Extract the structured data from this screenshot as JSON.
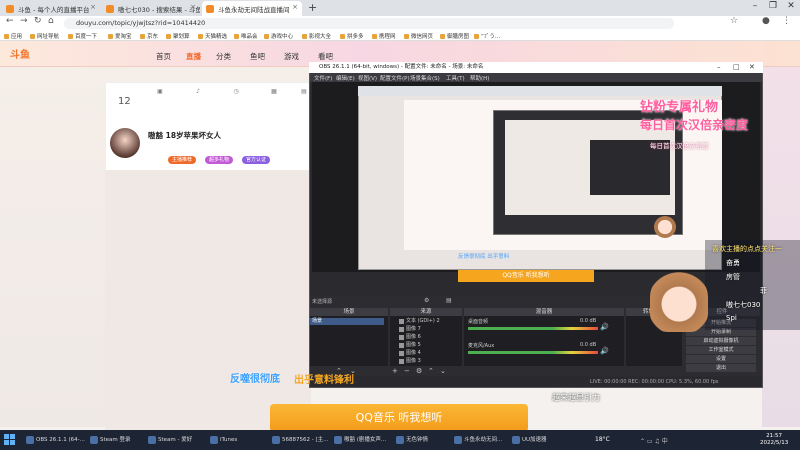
{
  "browser": {
    "tabs": [
      {
        "label": "斗鱼 - 每个人的直播平台"
      },
      {
        "label": "嗷七七030 - 搜索结果 - 斗鱼直播"
      },
      {
        "label": "斗鱼永劫无间陆战直播间"
      }
    ],
    "url": "douyu.com/topic/yjwjtsz?rid=10414420",
    "bookmarks": [
      "应用",
      "网址导航",
      "百度一下",
      "爱淘宝",
      "京东",
      "聚划算",
      "天猫精选",
      "唯品会",
      "游戏中心",
      "影视大全",
      "拼多多",
      "携程网",
      "微信网页",
      "御膳房图",
      "“ﾌﾞう..."
    ]
  },
  "site": {
    "logo": "斗鱼",
    "nav": [
      "首页",
      "直播",
      "分类",
      "鱼吧",
      "游戏",
      "看吧"
    ],
    "room": {
      "count": "12",
      "streamer_name": "嗷豁 18岁苹果坏女人",
      "chips": [
        "主播推荐",
        "超多礼物",
        "官方认证"
      ]
    }
  },
  "promo": {
    "line1": "钻粉专属礼物",
    "line2": "每日首次汉倍亲密度",
    "line3": "每日首次汉倍亲密度"
  },
  "obs": {
    "title": "OBS 26.1.1 (64-bit, windows) - 配置文件: 未命名 - 场景: 未命名",
    "menu": [
      "文件(F)",
      "编辑(E)",
      "视图(V)",
      "配置文件(P)",
      "场景集合(S)",
      "工具(T)",
      "帮助(H)"
    ],
    "inner_banner": "反馈很彻底 出乎意料",
    "inner_yellow": "QQ音乐 听我想听",
    "no_source": "未选择源",
    "dock_titles": [
      "场景",
      "来源",
      "混音器",
      "转场特效",
      "控件"
    ],
    "scene_item": "场景",
    "sources": [
      "文本 (GDI+) 2",
      "图像 7",
      "图像 6",
      "图像 5",
      "图像 4",
      "图像 3"
    ],
    "mixer": [
      {
        "name": "桌面音频",
        "level": "0.0 dB"
      },
      {
        "name": "麦克风/Aux",
        "level": "0.0 dB"
      }
    ],
    "controls": [
      "开始推流",
      "开始录制",
      "启动虚拟摄像机",
      "工作室模式",
      "设置",
      "退出"
    ],
    "status": "LIVE: 00:00:00   REC: 00:00:00   CPU: 5.3%, 60.00 fps"
  },
  "overlay": {
    "banner_blue": "反噬很彻底",
    "banner_orange": "出乎意料锋利",
    "music": "QQ音乐 听我想听",
    "badge": "越来越显引力",
    "chat": [
      "喜欢主播的点点关注一",
      "奋勇",
      "房管",
      "菲",
      "嗷七七030",
      "Spi"
    ]
  },
  "taskbar": {
    "items": [
      "OBS 26.1.1 (64-...",
      "Steam 登录",
      "Steam - 爱好",
      "iTunes",
      "56887562 - [主...",
      "嗷豁 (剧播女声...",
      "无色钟情",
      "斗鱼永劫无间...",
      "UU加速器"
    ],
    "weather": "18°C",
    "time": "21:57",
    "date": "2022/5/13"
  },
  "colors": {
    "accent": "#f06a2c",
    "promo_pink": "#ff5f9e",
    "obs_bg": "#2b2b2f",
    "music_orange": "#f6a51e"
  }
}
